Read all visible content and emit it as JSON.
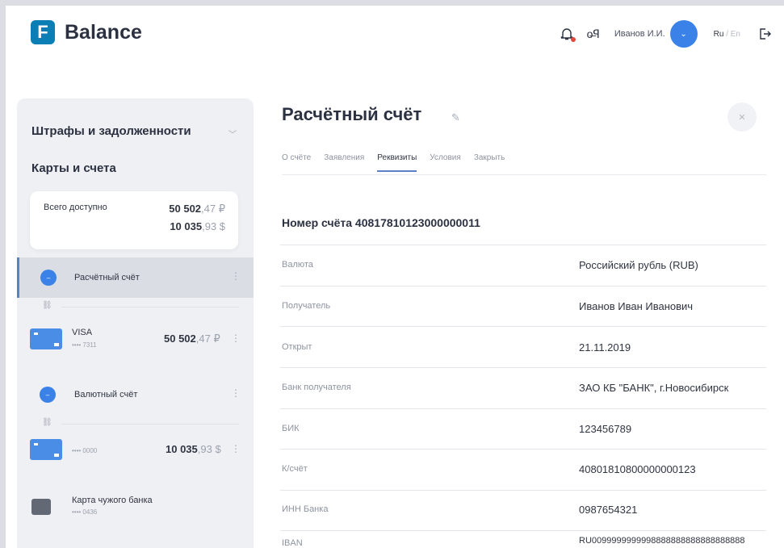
{
  "header": {
    "logo_letter": "F",
    "app_name": "Balance",
    "user_name": "Иванов И.И.",
    "lang_ru": "Ru",
    "lang_sep": "/",
    "lang_en": "En"
  },
  "sidebar": {
    "fines_title": "Штрафы и задолженности",
    "cards_title": "Карты и счета",
    "available": {
      "label": "Всего доступно",
      "rub_int": "50 502",
      "rub_frac": ",47 ₽",
      "usd_int": "10 035",
      "usd_frac": ",93 $"
    },
    "accounts": [
      {
        "name": "Расчётный счёт",
        "card_name": "VISA",
        "card_num": "•••• 7311",
        "card_int": "50 502",
        "card_frac": ",47 ₽"
      },
      {
        "name": "Валютный счёт",
        "card_num": "•••• 0000",
        "card_int": "10 035",
        "card_frac": ",93 $"
      }
    ],
    "other_card": {
      "name": "Карта чужого банка",
      "num": "•••• 0436"
    }
  },
  "main": {
    "title": "Расчётный счёт",
    "tabs": [
      "О счёте",
      "Заявления",
      "Реквизиты",
      "Условия",
      "Закрыть"
    ],
    "active_tab": "Реквизиты",
    "account_number": "Номер счёта 40817810123000000011",
    "rows": [
      {
        "label": "Валюта",
        "value": "Российский рубль (RUB)"
      },
      {
        "label": "Получатель",
        "value": "Иванов Иван Иванович"
      },
      {
        "label": "Открыт",
        "value": "21.11.2019"
      },
      {
        "label": "Банк получателя",
        "value": "ЗАО КБ \"БАНК\", г.Новосибирск"
      },
      {
        "label": "БИК",
        "value": "123456789"
      },
      {
        "label": "К/счёт",
        "value": "40801810800000000123"
      },
      {
        "label": "ИНН Банка",
        "value": "0987654321"
      },
      {
        "label": "IBAN",
        "value": "RU0099999999998888888888888888888"
      }
    ]
  },
  "icons": {
    "bell": "bell-icon",
    "key": "key-icon",
    "chevron": "chevron-down-icon",
    "logout": "logout-icon",
    "pencil": "pencil-icon",
    "close": "close-icon",
    "link": "link-icon",
    "kebab": "kebab-menu-icon"
  },
  "colors": {
    "accent": "#3b82e8",
    "logo": "#0b7fb5",
    "notification": "#e4463a"
  }
}
